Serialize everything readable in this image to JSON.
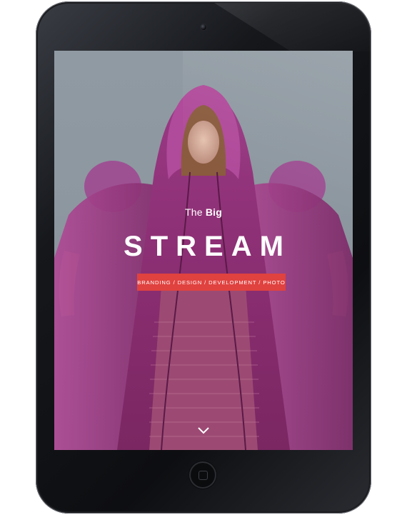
{
  "hero": {
    "subtitle_pre": "The ",
    "subtitle_bold": "Big",
    "title": "STREAM",
    "tagline": "BRANDING / DESIGN / DEVELOPMENT / PHOTO"
  },
  "icons": {
    "scroll_down": "chevron-down-icon",
    "camera": "camera-icon",
    "home": "home-button-icon"
  },
  "colors": {
    "tag_background": "#e0423f",
    "screen_background": "#8d97a0",
    "cloak": "#8a2f70",
    "device_frame": "#111215"
  }
}
